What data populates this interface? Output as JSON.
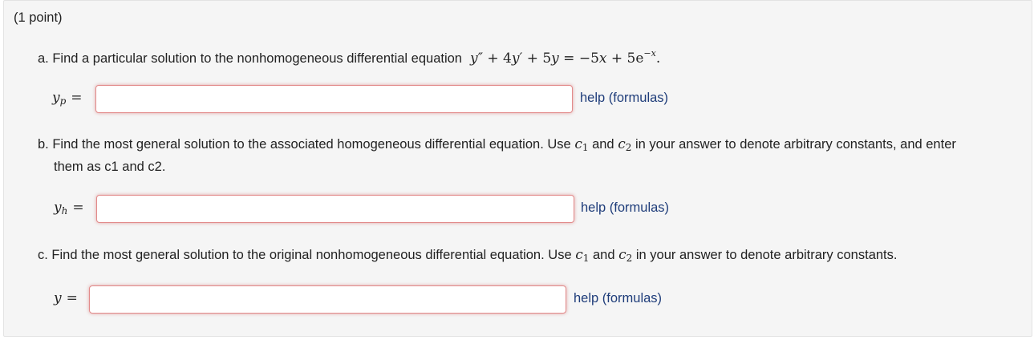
{
  "problem": {
    "points": "(1 point)",
    "part_a": {
      "prefix": "a. Find a particular solution to the nonhomogeneous differential equation",
      "label_var": "y",
      "label_sub": "p",
      "input_value": "",
      "help": "help (formulas)"
    },
    "part_b": {
      "line1_prefix": "b. Find the most general solution to the associated homogeneous differential equation. Use",
      "and": "and",
      "line1_suffix": "in your answer to denote arbitrary constants, and enter",
      "line2": "them as c1 and c2.",
      "label_var": "y",
      "label_sub": "h",
      "input_value": "",
      "help": "help (formulas)"
    },
    "part_c": {
      "prefix": "c. Find the most general solution to the original nonhomogeneous differential equation. Use",
      "and": "and",
      "suffix": "in your answer to denote arbitrary constants.",
      "label_var": "y",
      "input_value": "",
      "help": "help (formulas)"
    }
  }
}
